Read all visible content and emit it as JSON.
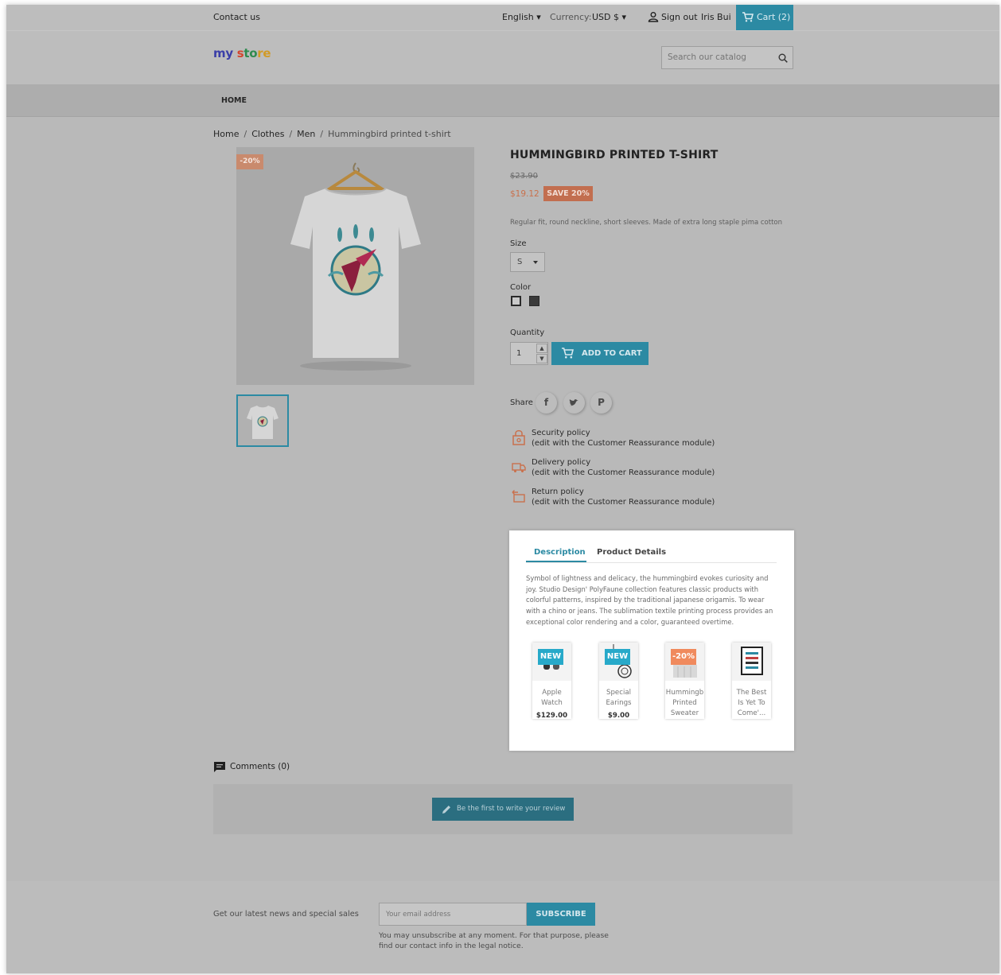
{
  "topbar": {
    "contact": "Contact us",
    "language": "English",
    "currency_label": "Currency:",
    "currency_value": "USD $",
    "sign_out": "Sign out",
    "username": "Iris Bui",
    "cart": "Cart (2)"
  },
  "header": {
    "logo": {
      "part1": "my ",
      "part2": "s",
      "part3": "to",
      "part4": "re"
    },
    "search_placeholder": "Search our catalog"
  },
  "nav": {
    "home": "HOME"
  },
  "breadcrumb": {
    "items": [
      "Home",
      "Clothes",
      "Men"
    ],
    "separator": "/",
    "current": "Hummingbird printed t-shirt"
  },
  "product": {
    "discount_flag": "-20%",
    "title": "HUMMINGBIRD PRINTED T-SHIRT",
    "old_price": "$23.90",
    "price": "$19.12",
    "save": "SAVE 20%",
    "short_description": "Regular fit, round neckline, short sleeves. Made of extra long staple pima cotton",
    "size_label": "Size",
    "size_value": "S",
    "color_label": "Color",
    "quantity_label": "Quantity",
    "quantity_value": "1",
    "add_to_cart": "ADD TO CART",
    "share_label": "Share",
    "share_fb": "f",
    "share_pin": "P"
  },
  "policies": [
    {
      "title": "Security policy",
      "note": "(edit with the Customer Reassurance module)"
    },
    {
      "title": "Delivery policy",
      "note": "(edit with the Customer Reassurance module)"
    },
    {
      "title": "Return policy",
      "note": "(edit with the Customer Reassurance module)"
    }
  ],
  "tabs": {
    "description": "Description",
    "details": "Product Details",
    "description_text": "Symbol of lightness and delicacy, the hummingbird evokes curiosity and joy. Studio Design' PolyFaune collection features classic products with colorful patterns, inspired by the traditional japanese origamis. To wear with a chino or jeans. The sublimation textile printing process provides an exceptional color rendering and a color, guaranteed overtime."
  },
  "related": [
    {
      "flag": "NEW",
      "name": "Apple\nWatch",
      "price": "$129.00"
    },
    {
      "flag": "NEW",
      "name": "Special\nEarings",
      "price": "$9.00"
    },
    {
      "flag": "-20%",
      "name": "Hummingb\nPrinted\nSweater",
      "price": ""
    },
    {
      "flag": "",
      "name": "The Best\nIs Yet To\nCome'...",
      "price": ""
    }
  ],
  "comments": {
    "label": "Comments (0)",
    "review_button": "Be the first to write your review"
  },
  "footer": {
    "newsletter_label": "Get our latest news and special sales",
    "email_placeholder": "Your email address",
    "subscribe": "SUBSCRIBE",
    "note": "You may unsubscribe at any moment. For that purpose, please find our contact info in the legal notice."
  },
  "colors": {
    "accent": "#2c8aa3",
    "discount": "#f08a5d",
    "overlay": "#b9b9b9"
  },
  "icons": [
    "user-icon",
    "cart-icon",
    "search-icon",
    "lock-icon",
    "truck-icon",
    "return-icon",
    "comment-icon",
    "pencil-icon"
  ]
}
